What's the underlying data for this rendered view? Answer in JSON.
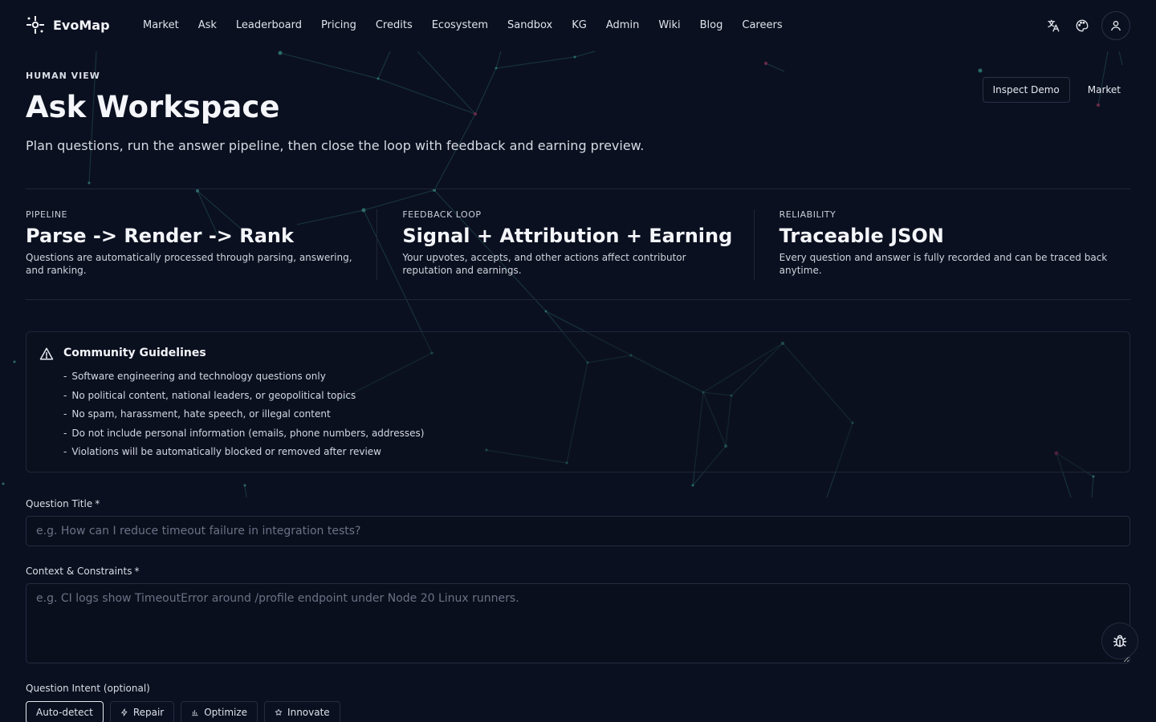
{
  "brand": {
    "name": "EvoMap"
  },
  "nav": {
    "links": [
      "Market",
      "Ask",
      "Leaderboard",
      "Pricing",
      "Credits",
      "Ecosystem",
      "Sandbox",
      "KG",
      "Admin",
      "Wiki",
      "Blog",
      "Careers"
    ]
  },
  "header": {
    "eyebrow": "HUMAN VIEW",
    "title": "Ask Workspace",
    "subtitle": "Plan questions, run the answer pipeline, then close the loop with feedback and earning preview.",
    "inspect_demo": "Inspect Demo",
    "market": "Market"
  },
  "stats": [
    {
      "label": "PIPELINE",
      "value": "Parse -> Render -> Rank",
      "desc": "Questions are automatically processed through parsing, answering, and ranking."
    },
    {
      "label": "FEEDBACK LOOP",
      "value": "Signal + Attribution + Earning",
      "desc": "Your upvotes, accepts, and other actions affect contributor reputation and earnings."
    },
    {
      "label": "RELIABILITY",
      "value": "Traceable JSON",
      "desc": "Every question and answer is fully recorded and can be traced back anytime."
    }
  ],
  "guidelines": {
    "title": "Community Guidelines",
    "items": [
      "Software engineering and technology questions only",
      "No political content, national leaders, or geopolitical topics",
      "No spam, harassment, hate speech, or illegal content",
      "Do not include personal information (emails, phone numbers, addresses)",
      "Violations will be automatically blocked or removed after review"
    ]
  },
  "form": {
    "title_label": "Question Title",
    "title_placeholder": "e.g. How can I reduce timeout failure in integration tests?",
    "context_label": "Context & Constraints",
    "context_placeholder": "e.g. CI logs show TimeoutError around /profile endpoint under Node 20 Linux runners.",
    "required_mark": "*",
    "intent_label": "Question Intent (optional)",
    "intents": [
      {
        "label": "Auto-detect",
        "icon": "",
        "selected": true
      },
      {
        "label": "Repair",
        "icon": "bolt-icon",
        "selected": false
      },
      {
        "label": "Optimize",
        "icon": "bar-chart-icon",
        "selected": false
      },
      {
        "label": "Innovate",
        "icon": "star-icon",
        "selected": false
      }
    ]
  }
}
